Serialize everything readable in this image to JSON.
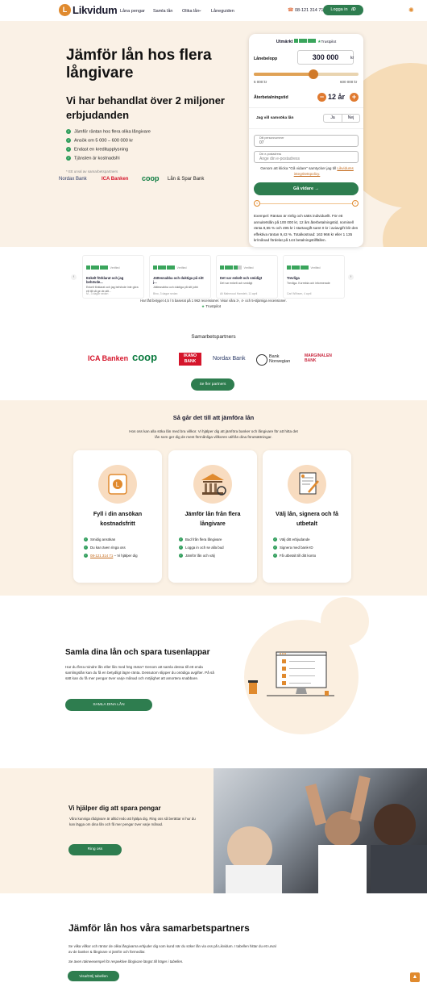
{
  "header": {
    "logo_mark": "L",
    "logo_text": "Likvidum",
    "nav": [
      "Låna pengar",
      "Samla lån",
      "Olika lån",
      "Låneguiden"
    ],
    "nav_dropdown_arrow": "⌄",
    "phone": "08-121 314 71",
    "login_label": "Logga in",
    "login_badge": "iD"
  },
  "hero": {
    "title": "Jämför lån hos flera långivare",
    "subtitle": "Vi har behandlat över 2 miljoner erbjudanden",
    "checks": [
      "Jämför räntan hos flera olika långivare",
      "Ansök om 5 000 – 600 000 kr",
      "Endast en kreditupplysning",
      "Tjänsten är kostnadsfri"
    ],
    "partners_note": "* Ett urval av samarbetspartners",
    "logos": [
      "Nordax Bank",
      "ICA Banken",
      "coop",
      "Lån & Spar Bank"
    ]
  },
  "form": {
    "trustpilot_label": "Utmärkt",
    "trustpilot_brand": "Trustpilot",
    "amount_label": "Lånebelopp",
    "amount_value": "300 000",
    "amount_unit": "kr",
    "amount_fraction": 0.57,
    "min_label": "5 000 kr",
    "max_label": "600 000 kr",
    "term_label": "Återbetalningstid",
    "term_value": "12 år",
    "minus": "−",
    "plus": "+",
    "co_label": "Jag vill samsöka lån",
    "yes": "Ja",
    "no": "Nej",
    "ssn_label": "Ditt personnummer",
    "ssn_value": "07",
    "email_label": "Din e-postadress",
    "email_placeholder": "Ange din e-postadress",
    "consent_text": "Genom att klicka \"Gå vidare\" samtycker jag till",
    "consent_link": "Likvidums integritetspolicy.",
    "continue_label": "Gå vidare →",
    "step1": "1",
    "step2": "2",
    "example_text": "Exempel: Räntan är rörlig och sätts individuellt. För ett annuitetslån på 100 000 kr, 12 års återbetalningstid, nominell ränta 8,55 % och 495 kr i startavgift samt 0 kr i aviavgift blir den effektiva räntan 9,43 %. Totalkostnad: 163 966 kr eller 1 135 kr/månad fördelat på 144 betalningstillfällen."
  },
  "reviews": {
    "items": [
      {
        "verified": "Verified",
        "title": "Enkelt förklarat och jag behövde...",
        "body": "Enkelt förklarat och jag behövde inte göra ett till så ge de allt...",
        "author": "M., 3 dagar sedan"
      },
      {
        "verified": "Verified",
        "title": "Jättesnabba och duktiga på sitt j...",
        "body": "Jättesnabba och duktiga på sitt jobb",
        "author": "Bino, 3 dagar sedan"
      },
      {
        "verified": "Verified",
        "title": "Det var enkelt och smidigt",
        "body": "Det var enkelt och smidigt",
        "author": "Ali Mahmoud Hamdeh, 11 april"
      },
      {
        "verified": "Verified",
        "title": "Trevliga",
        "body": "Trevliga. Korrekta och informerade",
        "author": "Carl Wilhsen, 4 april"
      }
    ],
    "prev": "‹",
    "next": "›",
    "summary": "Har fått betyget 4,5 / 5 baserat på 1 962 recensioner. Visar våra 3-, 4- och 5-stjärniga recensioner.",
    "trustpilot": "Trustpilot",
    "star_glyph": "★"
  },
  "partners": {
    "title": "Samarbetspartners",
    "logos": [
      "ICA Banken",
      "coop",
      "IKANO BANK",
      "Nordax Bank",
      "Bank Norwegian",
      "MARGINALEN BANK"
    ],
    "button": "Se fler partners"
  },
  "how": {
    "title": "Så går det till att jämföra lån",
    "desc": "Hos oss kan alla söka lån med bra villkor. Vi hjälper dig att jämföra banker och långivare för att hitta det lån som ger dig de mest förmånliga villkoren utifrån dina förutsättningar.",
    "cards": [
      {
        "title": "Fyll i din ansökan kostnadsfritt",
        "items": [
          "Smidig ansökan",
          "Du kan även ringa oss",
          "– Vi hjälper dig"
        ],
        "phone": "08-121 314 71"
      },
      {
        "title": "Jämför lån från flera långivare",
        "items": [
          "Bud från flera långivare",
          "Logga in och se alla bud",
          "Jämför lån och välj"
        ]
      },
      {
        "title": "Välj lån, signera och få utbetalt",
        "items": [
          "Välj ditt erbjudande",
          "Signera med bank-ID",
          "Få utbetalt till ditt konto"
        ]
      }
    ]
  },
  "samla": {
    "title": "Samla dina lån och spara tusenlappar",
    "desc": "Har du flera mindre lån eller lån med hög ränta? Genom att samla dessa till ett enda samlingslån kan du få en betydligt lägre ränta. Dessutom slipper du onödiga avgifter. På så sätt kan du få mer pengar över varje månad och möjlighet att amortera snabbare.",
    "button": "SAMLA DINA LÅN"
  },
  "spara": {
    "title": "Vi hjälper dig att spara pengar",
    "desc": "Våra kunniga rådgivare är alltid redo att hjälpa dig. Ring oss så berättar vi hur du kan lägga om dina lån och få mer pengar över varje månad.",
    "button": "Ring oss"
  },
  "bottom": {
    "title": "Jämför lån hos våra samarbetspartners",
    "desc": "Se vilka villkor och räntor de olika långivarna erbjuder dig som kund när du söker lån via oss på Likvidum. I tabellen hittar du ett urval av de banker & långivare vi jämför och förmedlar.",
    "note": "Se även räkneexempel för respektive långivare längst till höger i tabellen.",
    "button": "Visa/Dölj tabellen"
  },
  "colors": {
    "accent": "#e08a2e",
    "brand_green": "#2e7d4f",
    "hero_bg": "#faf1e6",
    "trustpilot": "#3aa55c"
  },
  "icons": [
    "phone-icon",
    "sun-icon",
    "check-icon",
    "arrow-up-icon",
    "laptop-checklist-icon",
    "bank-icon",
    "contract-sign-icon"
  ]
}
